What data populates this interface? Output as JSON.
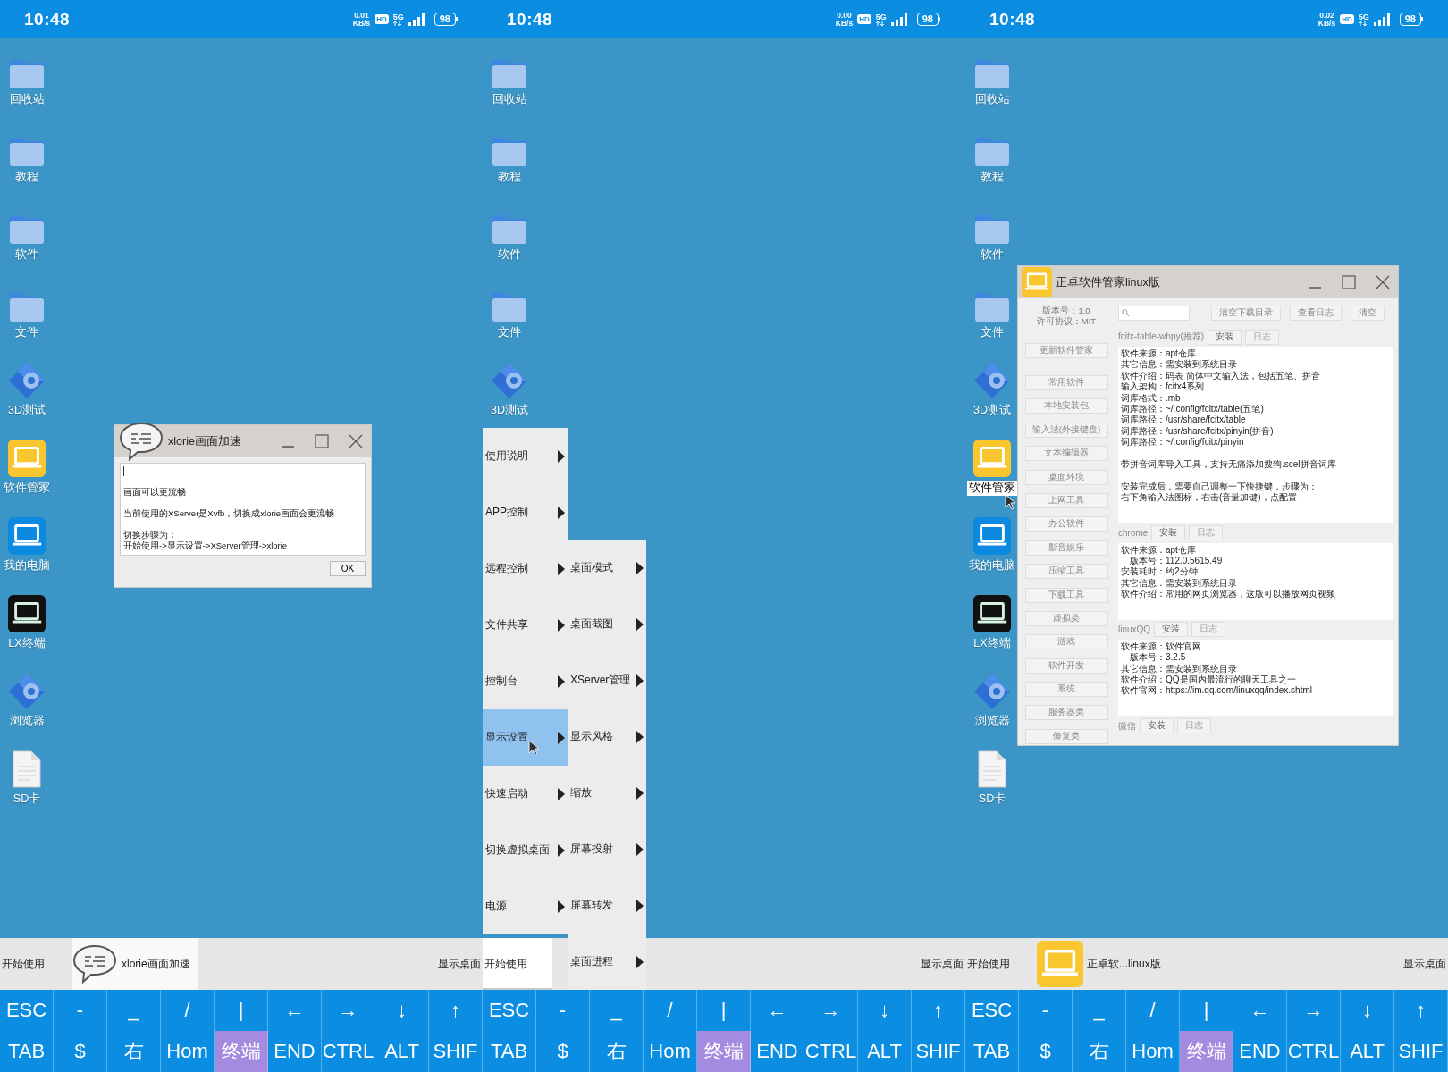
{
  "panels": [
    {
      "status": {
        "time": "10:48",
        "speed": "0.01",
        "speed_unit": "KB/s",
        "hd": "HD",
        "network": "5G",
        "battery": "98"
      },
      "desktop_icons": [
        {
          "label": "回收站",
          "kind": "folder",
          "selected": false
        },
        {
          "label": "教程",
          "kind": "folder",
          "selected": false
        },
        {
          "label": "软件",
          "kind": "folder",
          "selected": false
        },
        {
          "label": "文件",
          "kind": "folder",
          "selected": false
        },
        {
          "label": "3D测试",
          "kind": "gear",
          "selected": false
        },
        {
          "label": "软件管家",
          "kind": "manager",
          "selected": false
        },
        {
          "label": "我的电脑",
          "kind": "computer",
          "selected": false
        },
        {
          "label": "LX终端",
          "kind": "terminal",
          "selected": false
        },
        {
          "label": "浏览器",
          "kind": "gear",
          "selected": false
        },
        {
          "label": "SD卡",
          "kind": "document",
          "selected": false
        }
      ],
      "dialog": {
        "title": "xlorie画面加速",
        "paragraphs": [
          [
            "画面可以更流畅"
          ],
          [
            "当前使用的XServer是Xvfb，切换成xlorie画面会更流畅"
          ],
          [
            "切换步骤为：",
            "开始使用->显示设置->XServer管理->xlorie"
          ]
        ],
        "button": "OK"
      },
      "taskbar": {
        "start": {
          "label": "开始使用",
          "active": false
        },
        "tasks": [
          {
            "label": "xlorie画面加速",
            "kind": "chat",
            "active": true
          }
        ],
        "show_desktop": "显示桌面"
      },
      "keyboard": [
        [
          {
            "label": "ESC",
            "highlighted": false
          },
          {
            "label": "-",
            "highlighted": false
          },
          {
            "label": "_",
            "highlighted": false
          },
          {
            "label": "/",
            "highlighted": false
          },
          {
            "label": "|",
            "highlighted": false
          },
          {
            "label": "←",
            "highlighted": false
          },
          {
            "label": "→",
            "highlighted": false
          },
          {
            "label": "↓",
            "highlighted": false
          },
          {
            "label": "↑",
            "highlighted": false
          }
        ],
        [
          {
            "label": "TAB",
            "highlighted": false
          },
          {
            "label": "$",
            "highlighted": false
          },
          {
            "label": "右",
            "highlighted": false
          },
          {
            "label": "Hom",
            "highlighted": false
          },
          {
            "label": "终端",
            "highlighted": true
          },
          {
            "label": "END",
            "highlighted": false
          },
          {
            "label": "CTRL",
            "highlighted": false
          },
          {
            "label": "ALT",
            "highlighted": false
          },
          {
            "label": "SHIF",
            "highlighted": false
          }
        ]
      ]
    },
    {
      "status": {
        "time": "10:48",
        "speed": "0.00",
        "speed_unit": "KB/s",
        "hd": "HD",
        "network": "5G",
        "battery": "98"
      },
      "desktop_icons": [
        {
          "label": "回收站",
          "kind": "folder",
          "selected": false
        },
        {
          "label": "教程",
          "kind": "folder",
          "selected": false
        },
        {
          "label": "软件",
          "kind": "folder",
          "selected": false
        },
        {
          "label": "文件",
          "kind": "folder",
          "selected": false
        },
        {
          "label": "3D测试",
          "kind": "gear",
          "selected": false
        }
      ],
      "menu": {
        "items": [
          {
            "label": "使用说明",
            "selected": false
          },
          {
            "label": "APP控制",
            "selected": false
          },
          {
            "label": "远程控制",
            "selected": false
          },
          {
            "label": "文件共享",
            "selected": false
          },
          {
            "label": "控制台",
            "selected": false
          },
          {
            "label": "显示设置",
            "selected": true
          },
          {
            "label": "快速启动",
            "selected": false
          },
          {
            "label": "切换虚拟桌面",
            "selected": false
          },
          {
            "label": "电源",
            "selected": false
          }
        ],
        "submenu": [
          "桌面模式",
          "桌面截图",
          "XServer管理",
          "显示风格",
          "缩放",
          "屏幕投射",
          "屏幕转发",
          "桌面进程"
        ]
      },
      "taskbar": {
        "start": {
          "label": "开始使用",
          "active": true
        },
        "show_desktop": "显示桌面"
      },
      "keyboard": [
        [
          {
            "label": "ESC",
            "highlighted": false
          },
          {
            "label": "-",
            "highlighted": false
          },
          {
            "label": "_",
            "highlighted": false
          },
          {
            "label": "/",
            "highlighted": false
          },
          {
            "label": "|",
            "highlighted": false
          },
          {
            "label": "←",
            "highlighted": false
          },
          {
            "label": "→",
            "highlighted": false
          },
          {
            "label": "↓",
            "highlighted": false
          },
          {
            "label": "↑",
            "highlighted": false
          }
        ],
        [
          {
            "label": "TAB",
            "highlighted": false
          },
          {
            "label": "$",
            "highlighted": false
          },
          {
            "label": "右",
            "highlighted": false
          },
          {
            "label": "Hom",
            "highlighted": false
          },
          {
            "label": "终端",
            "highlighted": true
          },
          {
            "label": "END",
            "highlighted": false
          },
          {
            "label": "CTRL",
            "highlighted": false
          },
          {
            "label": "ALT",
            "highlighted": false
          },
          {
            "label": "SHIF",
            "highlighted": false
          }
        ]
      ]
    },
    {
      "status": {
        "time": "10:48",
        "speed": "0.02",
        "speed_unit": "KB/s",
        "hd": "HD",
        "network": "5G",
        "battery": "98"
      },
      "desktop_icons": [
        {
          "label": "回收站",
          "kind": "folder",
          "selected": false
        },
        {
          "label": "教程",
          "kind": "folder",
          "selected": false
        },
        {
          "label": "软件",
          "kind": "folder",
          "selected": false
        },
        {
          "label": "文件",
          "kind": "folder",
          "selected": false
        },
        {
          "label": "3D测试",
          "kind": "gear",
          "selected": false
        },
        {
          "label": "软件管家",
          "kind": "manager",
          "selected": true
        },
        {
          "label": "我的电脑",
          "kind": "computer",
          "selected": false
        },
        {
          "label": "LX终端",
          "kind": "terminal",
          "selected": false
        },
        {
          "label": "浏览器",
          "kind": "gear",
          "selected": false
        },
        {
          "label": "SD卡",
          "kind": "document",
          "selected": false
        }
      ],
      "app_window": {
        "title": "正卓软件管家linux版",
        "version": [
          "版本号：1.0",
          "许可协议：MIT"
        ],
        "sidebar": [
          "更新软件管家",
          "常用软件",
          "本地安装包",
          "输入法(外接键盘)",
          "文本编辑器",
          "桌面环境",
          "上网工具",
          "办公软件",
          "影音娱乐",
          "压缩工具",
          "下载工具",
          "虚拟类",
          "游戏",
          "软件开发",
          "系统",
          "服务器类",
          "修复类"
        ],
        "toolbar": [
          "清空下载目录",
          "查看日志",
          "清空"
        ],
        "entries": [
          {
            "name": "fcitx-table-wbpy(推荐)",
            "buttons": [
              {
                "label": "安装",
                "disabled": false
              },
              {
                "label": "日志",
                "disabled": true
              }
            ],
            "fields": [
              {
                "label": "软件来源：",
                "value": "apt仓库"
              },
              {
                "label": "其它信息：",
                "value": "需安装到系统目录"
              },
              {
                "label": "软件介绍：",
                "value": "码表 简体中文输入法，包括五笔、拼音"
              },
              {
                "label": "输入架构：",
                "value": "fcitx4系列"
              },
              {
                "label": "词库格式：",
                "value": ".mb"
              },
              {
                "label": "词库路径：",
                "value": "~/.config/fcitx/table(五笔)"
              },
              {
                "label": "词库路径：",
                "value": "/usr/share/fcitx/table"
              },
              {
                "label": "词库路径：",
                "value": "/usr/share/fcitx/pinyin(拼音)"
              },
              {
                "label": "词库路径：",
                "value": "~/.config/fcitx/pinyin"
              }
            ],
            "notes": [
              [
                "带拼音词库导入工具，支持无痛添加搜狗.scel拼音词库"
              ],
              [
                "安装完成后，需要自己调整一下快捷键，步骤为：",
                "右下角输入法图标，右击(音量加键)，点配置"
              ]
            ]
          },
          {
            "name": "chrome",
            "buttons": [
              {
                "label": "安装",
                "disabled": false
              },
              {
                "label": "日志",
                "disabled": true
              }
            ],
            "fields": [
              {
                "label": "软件来源：",
                "value": "apt仓库"
              },
              {
                "label": "版本号：",
                "value": "112.0.5615.49"
              },
              {
                "label": "安装耗时：",
                "value": "约2分钟"
              },
              {
                "label": "其它信息：",
                "value": "需安装到系统目录"
              },
              {
                "label": "软件介绍：",
                "value": "常用的网页浏览器，这版可以播放网页视频"
              }
            ]
          },
          {
            "name": "linuxQQ",
            "buttons": [
              {
                "label": "安装",
                "disabled": false
              },
              {
                "label": "日志",
                "disabled": true
              }
            ],
            "fields": [
              {
                "label": "软件来源：",
                "value": "软件官网"
              },
              {
                "label": "版本号：",
                "value": "3.2.5"
              },
              {
                "label": "其它信息：",
                "value": "需安装到系统目录"
              },
              {
                "label": "软件介绍：",
                "value": "QQ是国内最流行的聊天工具之一"
              },
              {
                "label": "软件官网：",
                "value": "https://im.qq.com/linuxqq/index.shtml"
              }
            ]
          },
          {
            "name": "微信",
            "buttons": [
              {
                "label": "安装",
                "disabled": false
              },
              {
                "label": "日志",
                "disabled": true
              }
            ]
          }
        ]
      },
      "taskbar": {
        "start": {
          "label": "开始使用",
          "active": false
        },
        "tasks": [
          {
            "label": "正卓软...linux版",
            "kind": "manager",
            "active": false
          }
        ],
        "show_desktop": "显示桌面"
      },
      "keyboard": [
        [
          {
            "label": "ESC",
            "highlighted": false
          },
          {
            "label": "-",
            "highlighted": false
          },
          {
            "label": "_",
            "highlighted": false
          },
          {
            "label": "/",
            "highlighted": false
          },
          {
            "label": "|",
            "highlighted": false
          },
          {
            "label": "←",
            "highlighted": false
          },
          {
            "label": "→",
            "highlighted": false
          },
          {
            "label": "↓",
            "highlighted": false
          },
          {
            "label": "↑",
            "highlighted": false
          }
        ],
        [
          {
            "label": "TAB",
            "highlighted": false
          },
          {
            "label": "$",
            "highlighted": false
          },
          {
            "label": "右",
            "highlighted": false
          },
          {
            "label": "Hom",
            "highlighted": false
          },
          {
            "label": "终端",
            "highlighted": true
          },
          {
            "label": "END",
            "highlighted": false
          },
          {
            "label": "CTRL",
            "highlighted": false
          },
          {
            "label": "ALT",
            "highlighted": false
          },
          {
            "label": "SHIF",
            "highlighted": false
          }
        ]
      ]
    }
  ]
}
